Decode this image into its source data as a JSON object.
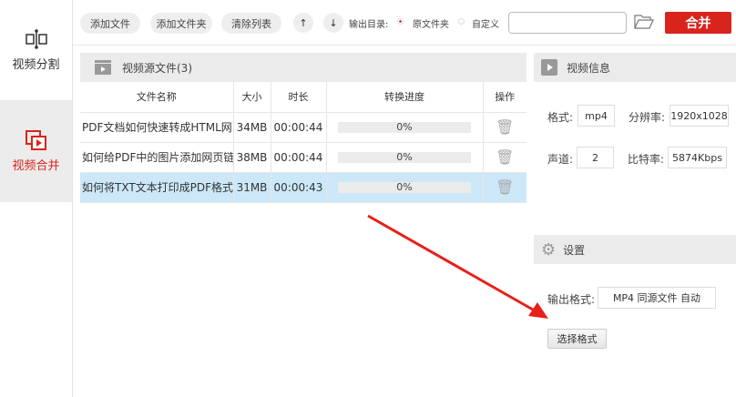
{
  "sidebar": {
    "items": [
      {
        "label": "视频分割",
        "icon": "split-icon"
      },
      {
        "label": "视频合并",
        "icon": "merge-icon",
        "active": true
      }
    ]
  },
  "toolbar": {
    "add_file": "添加文件",
    "add_folder": "添加文件夹",
    "clear_list": "清除列表",
    "move_up": "↑",
    "move_down": "↓",
    "output_dir_label": "输出目录:",
    "radio_source": "原文件夹",
    "radio_custom": "自定义",
    "path_value": "",
    "merge_button": "合并"
  },
  "files": {
    "title": "视频源文件(3)",
    "columns": [
      "文件名称",
      "大小",
      "时长",
      "转换进度",
      "操作"
    ],
    "rows": [
      {
        "name": "PDF文档如何快速转成HTML网...",
        "size": "34MB",
        "duration": "00:00:44",
        "progress": "0%"
      },
      {
        "name": "如何给PDF中的图片添加网页链...",
        "size": "38MB",
        "duration": "00:00:44",
        "progress": "0%"
      },
      {
        "name": "如何将TXT文本打印成PDF格式...",
        "size": "31MB",
        "duration": "00:00:43",
        "progress": "0%",
        "selected": true
      }
    ]
  },
  "info": {
    "title": "视频信息",
    "format_label": "格式:",
    "format": "mp4",
    "resolution_label": "分辨率:",
    "resolution": "1920x1028",
    "channel_label": "声道:",
    "channel": "2",
    "bitrate_label": "比特率:",
    "bitrate": "5874Kbps"
  },
  "settings": {
    "title": "设置",
    "output_format_label": "输出格式:",
    "output_format": "MP4 同源文件 自动",
    "choose_button": "选择格式"
  },
  "colors": {
    "accent": "#d9241c",
    "selected_row": "#cce8f8"
  }
}
